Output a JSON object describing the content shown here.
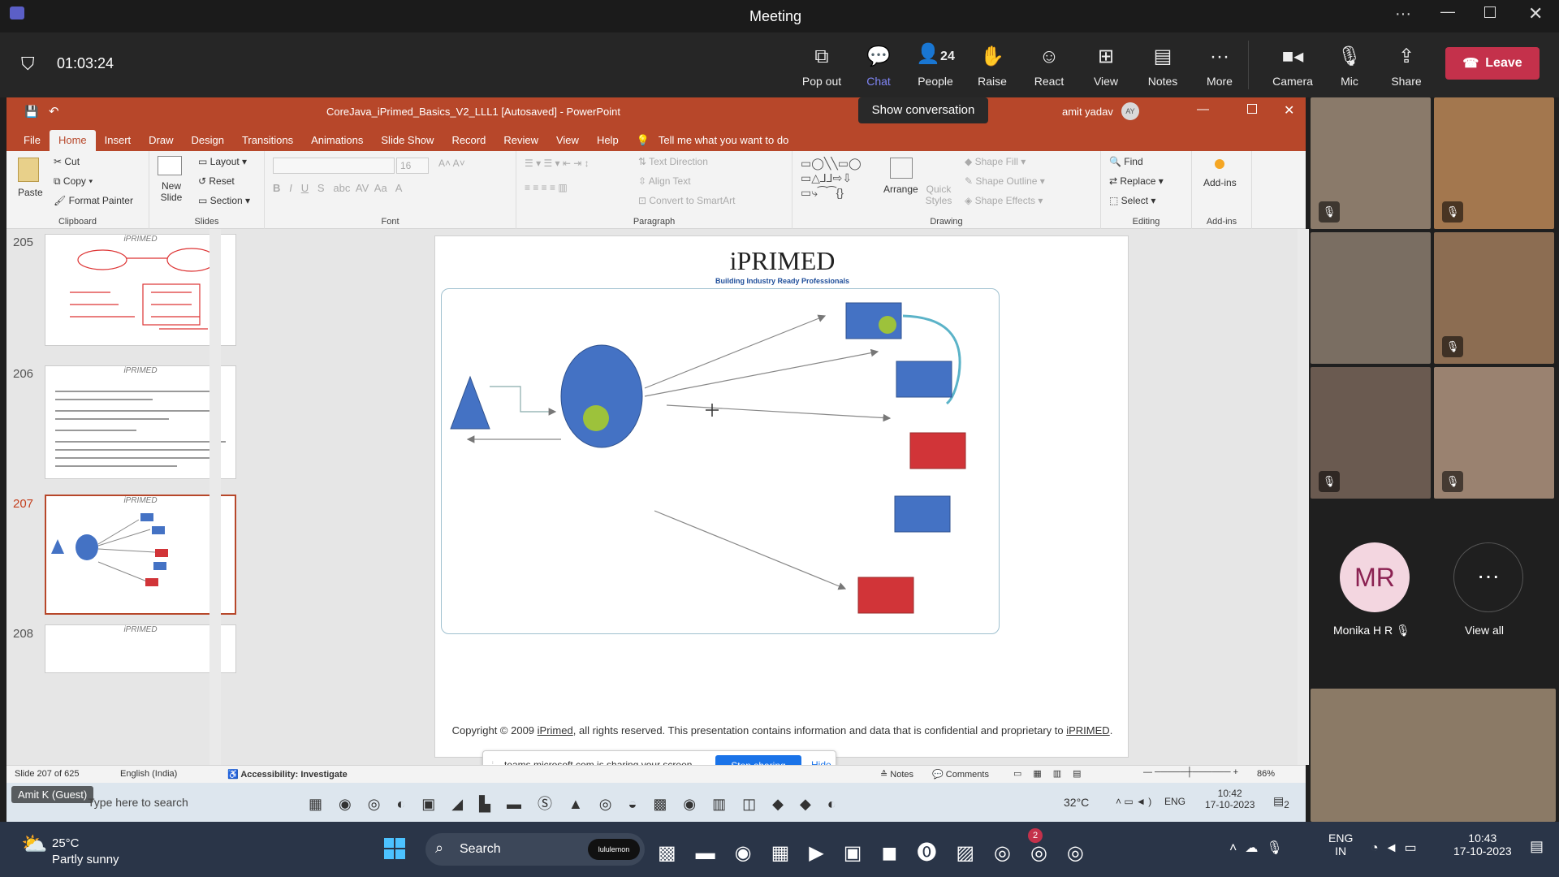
{
  "app": {
    "title": "Meeting",
    "timer": "01:03:24"
  },
  "controls": {
    "popout": "Pop out",
    "chat": "Chat",
    "people": "People",
    "people_count": "24",
    "raise": "Raise",
    "react": "React",
    "view": "View",
    "notes": "Notes",
    "more": "More",
    "camera": "Camera",
    "mic": "Mic",
    "share": "Share",
    "leave": "Leave",
    "tooltip": "Show conversation"
  },
  "ppt": {
    "title": "CoreJava_iPrimed_Basics_V2_LLL1 [Autosaved] - PowerPoint",
    "user": "amit yadav",
    "user_initials": "AY",
    "tabs": [
      "File",
      "Home",
      "Insert",
      "Draw",
      "Design",
      "Transitions",
      "Animations",
      "Slide Show",
      "Record",
      "Review",
      "View",
      "Help"
    ],
    "tell_me": "Tell me what you want to do",
    "ribbon": {
      "paste": "Paste",
      "cut": "Cut",
      "copy": "Copy",
      "format_painter": "Format Painter",
      "clipboard": "Clipboard",
      "new_slide": "New Slide",
      "layout": "Layout",
      "reset": "Reset",
      "section": "Section",
      "slides": "Slides",
      "font_size": "16",
      "font": "Font",
      "text_direction": "Text Direction",
      "align_text": "Align Text",
      "convert_smartart": "Convert to SmartArt",
      "paragraph": "Paragraph",
      "arrange": "Arrange",
      "quick_styles": "Quick Styles",
      "shape_fill": "Shape Fill",
      "shape_outline": "Shape Outline",
      "shape_effects": "Shape Effects",
      "drawing": "Drawing",
      "find": "Find",
      "replace": "Replace",
      "select": "Select",
      "editing": "Editing",
      "addins": "Add-ins",
      "addins_group": "Add-ins"
    },
    "slide_numbers": [
      "205",
      "206",
      "207",
      "208"
    ],
    "thumb_brand": "iPRIMED",
    "slide": {
      "logo": "iPRIMED",
      "tagline": "Building Industry Ready Professionals",
      "copyright_pre": "Copyright © 2009 ",
      "copyright_link1": "iPrimed",
      "copyright_mid": ", all rights reserved. This presentation contains information  and data  that is confidential and proprietary to ",
      "copyright_link2": "iPRIMED",
      "copyright_end": "."
    },
    "sharing": {
      "text": "teams.microsoft.com is sharing your screen.",
      "stop": "Stop sharing",
      "hide": "Hide"
    },
    "status": {
      "slide": "Slide 207 of 625",
      "lang": "English (India)",
      "access": "Accessibility: Investigate",
      "notes": "Notes",
      "comments": "Comments",
      "zoom": "86%"
    },
    "remote_taskbar": {
      "presenter": "Amit K (Guest)",
      "search": "Type here to search",
      "temp": "32°C",
      "lang": "ENG",
      "time": "10:42",
      "date": "17-10-2023",
      "badge": "2"
    }
  },
  "participants": {
    "monika_initials": "MR",
    "monika_name": "Monika H R",
    "view_all": "View all"
  },
  "taskbar": {
    "weather_temp": "25°C",
    "weather_desc": "Partly sunny",
    "search": "Search",
    "search_chip": "lululemon",
    "teams_badge": "2",
    "lang1": "ENG",
    "lang2": "IN",
    "time": "10:43",
    "date": "17-10-2023"
  },
  "colors": {
    "ppt_red": "#b7472a",
    "leave": "#c4314b",
    "chat": "#7f85f5",
    "share_blue": "#1a73e8",
    "blue_shape": "#4472c4",
    "red_shape": "#d13438",
    "avatar_bg": "#f3d6e0",
    "avatar_text": "#8b2252"
  }
}
